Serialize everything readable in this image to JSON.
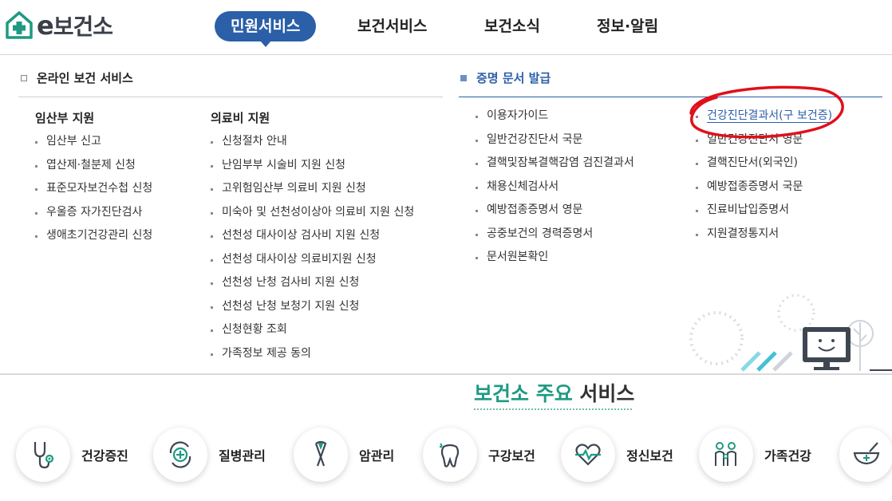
{
  "header": {
    "logo_text": "보건소",
    "logo_prefix": "e",
    "nav": [
      {
        "label": "민원서비스",
        "active": true
      },
      {
        "label": "보건서비스",
        "active": false
      },
      {
        "label": "보건소식",
        "active": false
      },
      {
        "label": "정보·알림",
        "active": false
      }
    ]
  },
  "panel": {
    "left_section": {
      "title": "온라인 보건 서비스",
      "columns": [
        {
          "heading": "임산부 지원",
          "items": [
            "임산부 신고",
            "엽산제·철분제 신청",
            "표준모자보건수첩 신청",
            "우울증 자가진단검사",
            "생애초기건강관리 신청"
          ]
        },
        {
          "heading": "의료비 지원",
          "items": [
            "신청절차 안내",
            "난임부부 시술비 지원 신청",
            "고위험임산부 의료비 지원 신청",
            "미숙아 및 선천성이상아 의료비 지원 신청",
            "선천성 대사이상 검사비 지원 신청",
            "선천성 대사이상 의료비지원 신청",
            "선천성 난청 검사비 지원 신청",
            "선천성 난청 보청기 지원 신청",
            "신청현황 조회",
            "가족정보 제공 동의"
          ]
        }
      ]
    },
    "right_section": {
      "title": "증명 문서 발급",
      "columns": [
        {
          "items": [
            "이용자가이드",
            "일반건강진단서 국문",
            "결핵및잠복결핵감염 검진결과서",
            "채용신체검사서",
            "예방접종증명서 영문",
            "공중보건의 경력증명서",
            "문서원본확인"
          ]
        },
        {
          "items": [
            "건강진단결과서(구 보건증)",
            "일반건강진단서 영문",
            "결핵진단서(외국인)",
            "예방접종증명서 국문",
            "진료비납입증명서",
            "지원결정통지서"
          ]
        }
      ]
    }
  },
  "services": {
    "title_highlight": "보건소 주요",
    "title_rest": " 서비스",
    "items": [
      {
        "label": "건강증진",
        "icon": "stethoscope-icon"
      },
      {
        "label": "질병관리",
        "icon": "medical-cross-cycle-icon"
      },
      {
        "label": "암관리",
        "icon": "ribbon-icon"
      },
      {
        "label": "구강보건",
        "icon": "tooth-icon"
      },
      {
        "label": "정신보건",
        "icon": "heart-pulse-icon"
      },
      {
        "label": "가족건강",
        "icon": "family-icon"
      },
      {
        "label": "",
        "icon": "mortar-bowl-icon"
      }
    ]
  },
  "colors": {
    "brand_blue": "#2b5fa8",
    "accent_green": "#1e9a82",
    "annotation_red": "#e0101a"
  }
}
